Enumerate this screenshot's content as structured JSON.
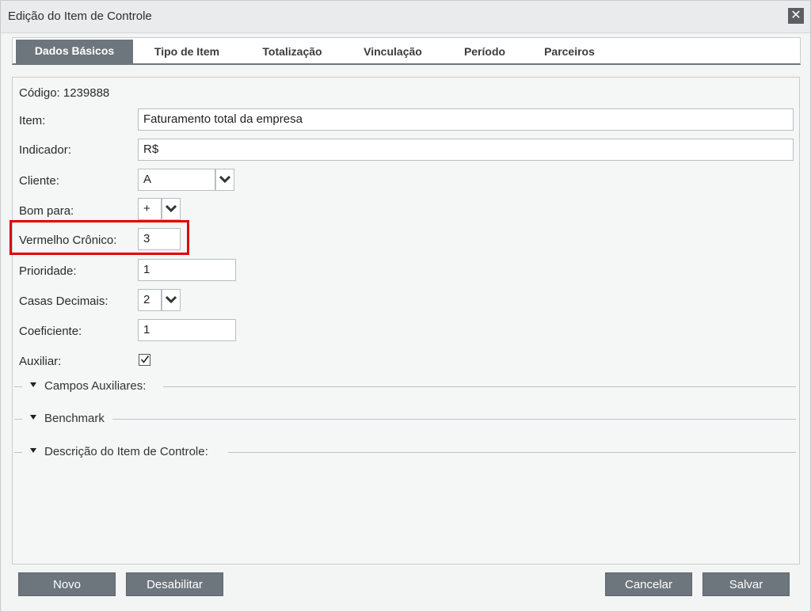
{
  "window": {
    "title": "Edição do Item de Controle",
    "close_glyph": "✕"
  },
  "tabs": [
    {
      "label": "Dados Básicos",
      "active": true
    },
    {
      "label": "Tipo de Item"
    },
    {
      "label": "Totalização"
    },
    {
      "label": "Vinculação"
    },
    {
      "label": "Período"
    },
    {
      "label": "Parceiros"
    }
  ],
  "form": {
    "codigo": "Código: 1239888",
    "item_label": "Item:",
    "item_value": "Faturamento total da empresa",
    "indicador_label": "Indicador:",
    "indicador_value": "R$",
    "cliente_label": "Cliente:",
    "cliente_value": "A",
    "bom_para_label": "Bom para:",
    "bom_para_value": "+",
    "vermelho_label": "Vermelho Crônico:",
    "vermelho_value": "3",
    "prioridade_label": "Prioridade:",
    "prioridade_value": "1",
    "casas_label": "Casas Decimais:",
    "casas_value": "2",
    "coeficiente_label": "Coeficiente:",
    "coeficiente_value": "1",
    "auxiliar_label": "Auxiliar:",
    "auxiliar_checked": true
  },
  "sections": [
    {
      "label": "Campos Auxiliares:"
    },
    {
      "label": "Benchmark"
    },
    {
      "label": "Descrição do Item de Controle:"
    }
  ],
  "buttons": {
    "novo": "Novo",
    "desabilitar": "Desabilitar",
    "cancelar": "Cancelar",
    "salvar": "Salvar"
  },
  "colors": {
    "tab_active": "#6d767d",
    "button": "#6d767d",
    "highlight": "#e00000"
  }
}
